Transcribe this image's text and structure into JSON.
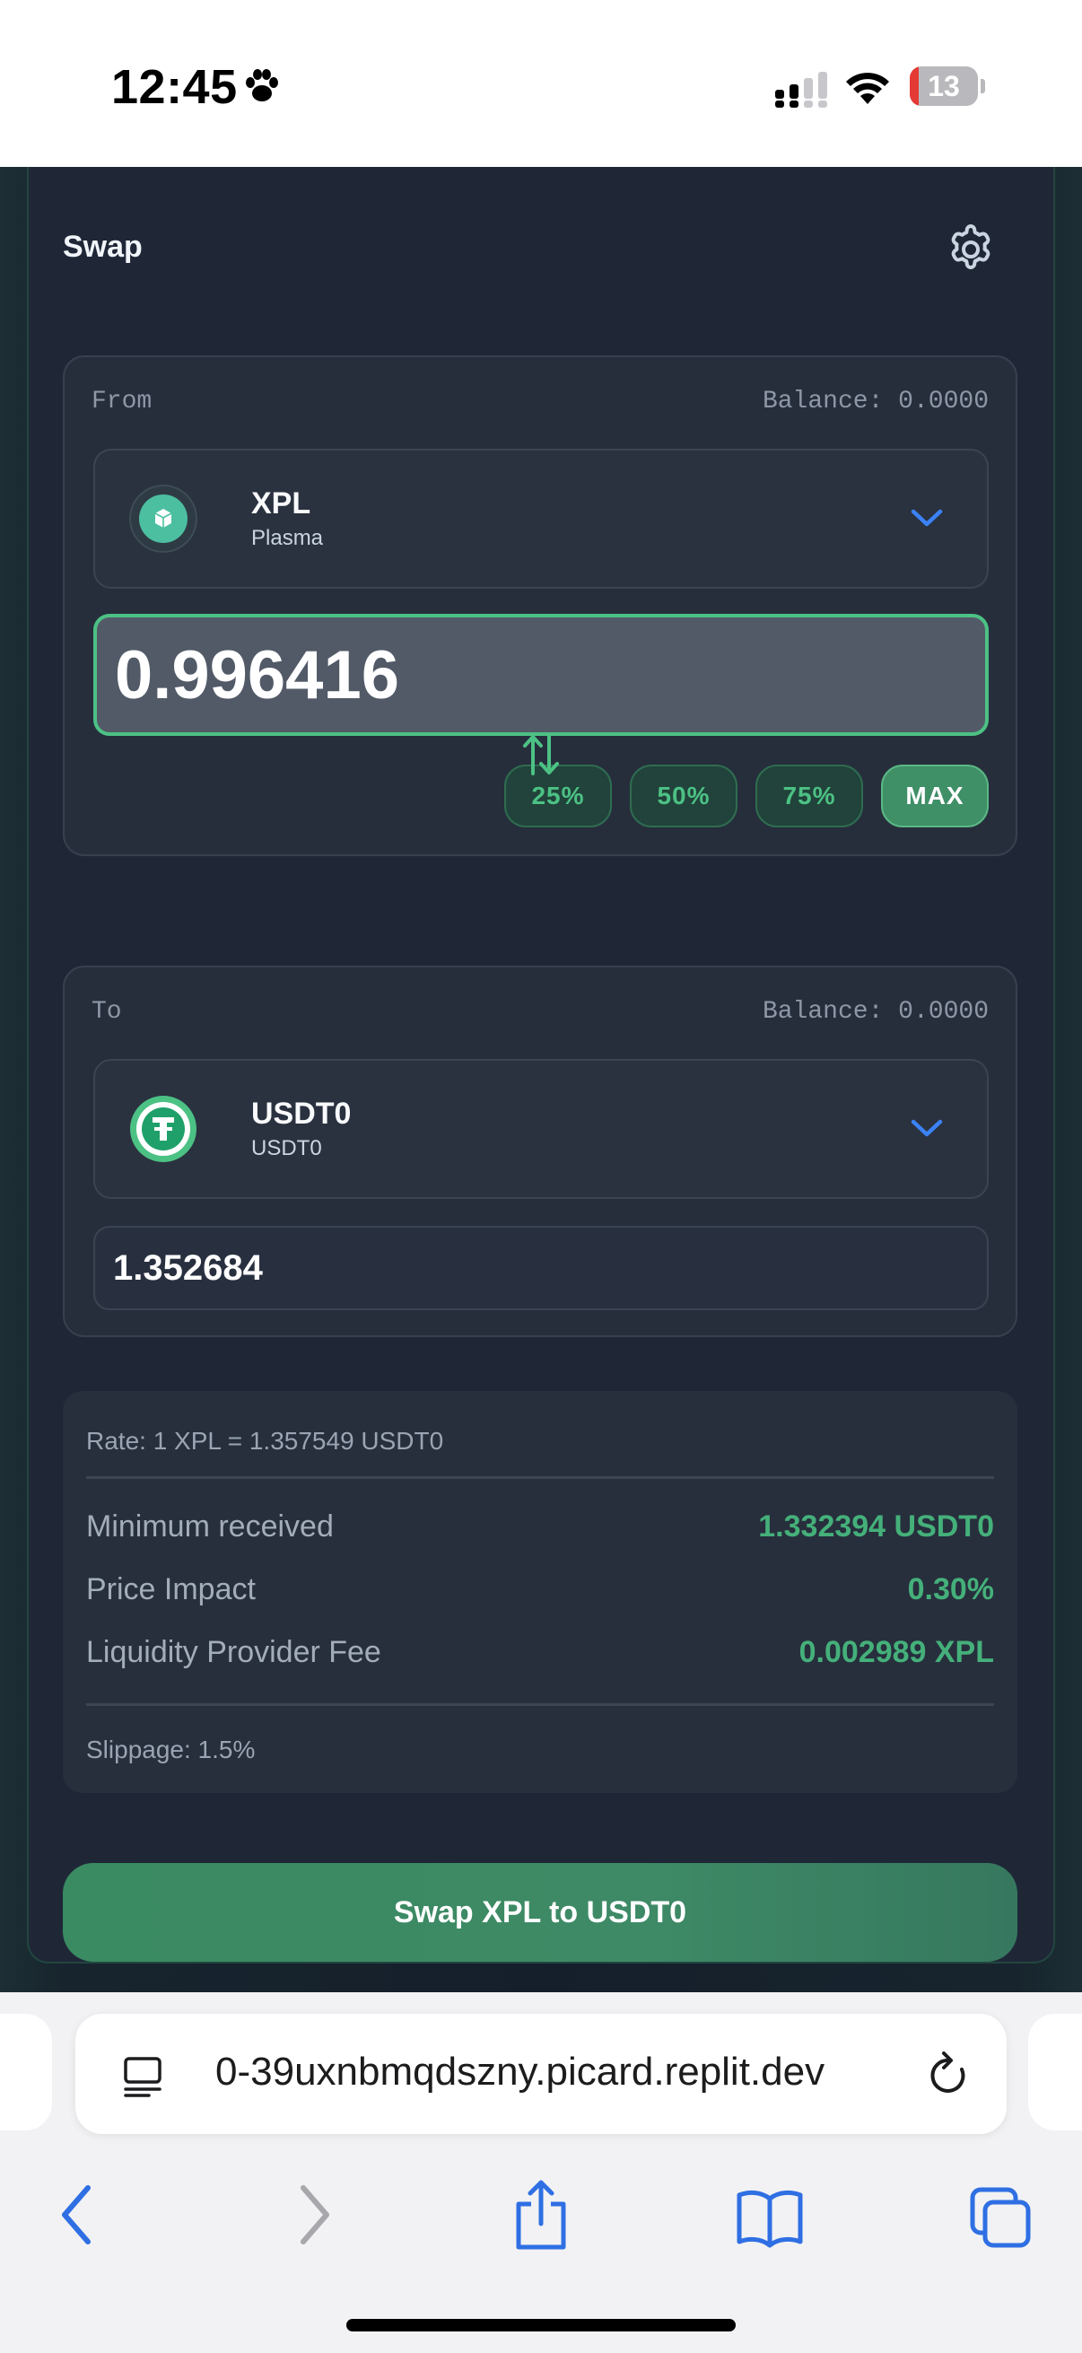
{
  "status_bar": {
    "time": "12:45",
    "battery_level": "13",
    "battery_fraction": 0.13,
    "icons": [
      "paw-icon",
      "signal-icon",
      "wifi-icon",
      "battery-icon"
    ]
  },
  "swap": {
    "title": "Swap",
    "settings_icon": "gear-icon",
    "from": {
      "label": "From",
      "balance": "Balance: 0.0000",
      "token_symbol": "XPL",
      "token_name": "Plasma",
      "amount": "0.996416",
      "percent_buttons": [
        "25%",
        "50%",
        "75%",
        "MAX"
      ]
    },
    "direction_icon": "swap-arrows-icon",
    "to": {
      "label": "To",
      "balance": "Balance: 0.0000",
      "token_symbol": "USDT0",
      "token_name": "USDT0",
      "amount": "1.352684"
    },
    "details": {
      "rate": "Rate: 1 XPL = 1.357549 USDT0",
      "rows": [
        {
          "label": "Minimum received",
          "value": "1.332394 USDT0"
        },
        {
          "label": "Price Impact",
          "value": "0.30%"
        },
        {
          "label": "Liquidity Provider Fee",
          "value": "0.002989 XPL"
        }
      ],
      "slippage": "Slippage: 1.5%"
    },
    "submit_label": "Swap XPL to USDT0"
  },
  "colors": {
    "accent_green": "#4cc184",
    "value_green": "#45b07a",
    "chevron_blue": "#3b82f6",
    "card_bg": "#1f2737"
  },
  "browser": {
    "url": "0-39uxnbmqdszny.picard.replit.dev",
    "nav_icons": [
      "back-icon",
      "forward-icon",
      "share-icon",
      "bookmarks-icon",
      "tabs-icon"
    ]
  }
}
